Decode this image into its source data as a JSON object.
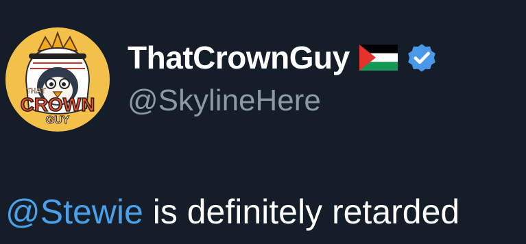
{
  "author": {
    "display_name": "ThatCrownGuy",
    "handle": "@SkylineHere",
    "flag_icon": "palestine-flag-icon",
    "verified_icon": "verified-badge-icon",
    "verified_color": "#4a99e9",
    "avatar_text_top": "THAT",
    "avatar_text_main": "CROWN",
    "avatar_text_bottom": "GUY"
  },
  "tweet": {
    "mention": "@Stewie",
    "text": " is definitely retarded"
  },
  "colors": {
    "background": "#151d28",
    "handle": "#8b98a5",
    "mention": "#4aa1ea",
    "text": "#ffffff",
    "avatar_bg": "#f3c149"
  }
}
